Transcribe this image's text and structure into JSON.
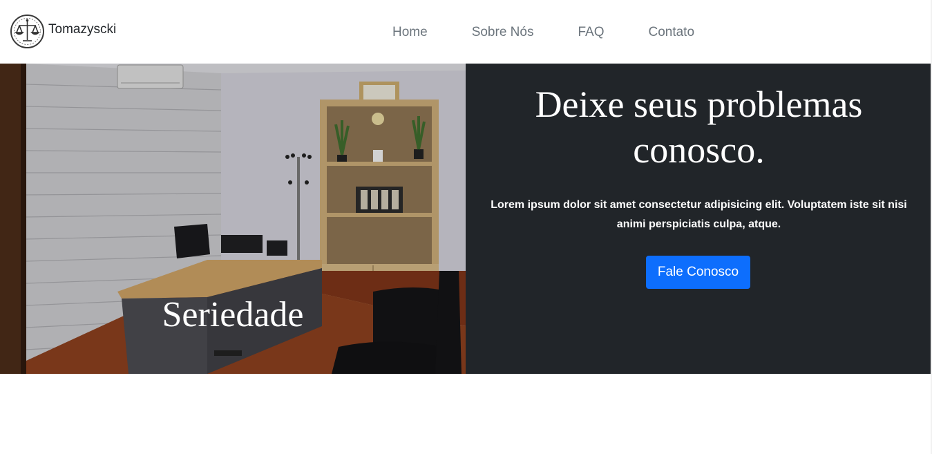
{
  "brand": {
    "name": "Tomazyscki",
    "logo_icon": "scales-of-justice-icon"
  },
  "nav": {
    "items": [
      {
        "label": "Home"
      },
      {
        "label": "Sobre Nós"
      },
      {
        "label": "FAQ"
      },
      {
        "label": "Contato"
      }
    ]
  },
  "hero": {
    "image_caption": "Seriedade",
    "title": "Deixe seus problemas conosco.",
    "text": "Lorem ipsum dolor sit amet consectetur adipisicing elit. Voluptatem iste sit nisi animi perspiciatis culpa, atque.",
    "button_label": "Fale Conosco"
  },
  "colors": {
    "panel_background": "#212529",
    "button_primary": "#0d6efd",
    "nav_text": "#6c757d"
  }
}
